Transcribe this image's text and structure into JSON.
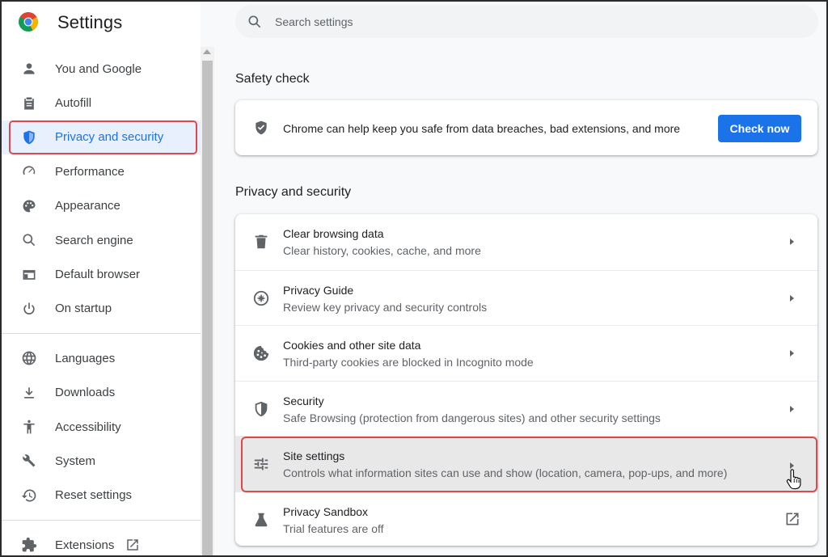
{
  "app": {
    "title": "Settings"
  },
  "search": {
    "placeholder": "Search settings"
  },
  "sidebar": {
    "items": [
      {
        "label": "You and Google",
        "icon": "person-icon"
      },
      {
        "label": "Autofill",
        "icon": "clipboard-icon"
      },
      {
        "label": "Privacy and security",
        "icon": "shield-icon",
        "active": true
      },
      {
        "label": "Performance",
        "icon": "speedometer-icon"
      },
      {
        "label": "Appearance",
        "icon": "palette-icon"
      },
      {
        "label": "Search engine",
        "icon": "search-icon"
      },
      {
        "label": "Default browser",
        "icon": "browser-window-icon"
      },
      {
        "label": "On startup",
        "icon": "power-icon"
      }
    ],
    "items2": [
      {
        "label": "Languages",
        "icon": "globe-icon"
      },
      {
        "label": "Downloads",
        "icon": "download-icon"
      },
      {
        "label": "Accessibility",
        "icon": "accessibility-icon"
      },
      {
        "label": "System",
        "icon": "wrench-icon"
      },
      {
        "label": "Reset settings",
        "icon": "history-icon"
      }
    ],
    "extensions": {
      "label": "Extensions",
      "icon": "puzzle-icon"
    }
  },
  "safety_check": {
    "heading": "Safety check",
    "text": "Chrome can help keep you safe from data breaches, bad extensions, and more",
    "button": "Check now"
  },
  "privacy": {
    "heading": "Privacy and security",
    "rows": [
      {
        "title": "Clear browsing data",
        "subtitle": "Clear history, cookies, cache, and more",
        "icon": "trash-icon"
      },
      {
        "title": "Privacy Guide",
        "subtitle": "Review key privacy and security controls",
        "icon": "compass-icon"
      },
      {
        "title": "Cookies and other site data",
        "subtitle": "Third-party cookies are blocked in Incognito mode",
        "icon": "cookie-icon"
      },
      {
        "title": "Security",
        "subtitle": "Safe Browsing (protection from dangerous sites) and other security settings",
        "icon": "shield-icon"
      },
      {
        "title": "Site settings",
        "subtitle": "Controls what information sites can use and show (location, camera, pop-ups, and more)",
        "icon": "sliders-icon"
      },
      {
        "title": "Privacy Sandbox",
        "subtitle": "Trial features are off",
        "icon": "flask-icon"
      }
    ]
  },
  "colors": {
    "accent": "#1a73e8",
    "highlight_outline": "#e0474c",
    "active_bg": "#e8f0fe"
  }
}
